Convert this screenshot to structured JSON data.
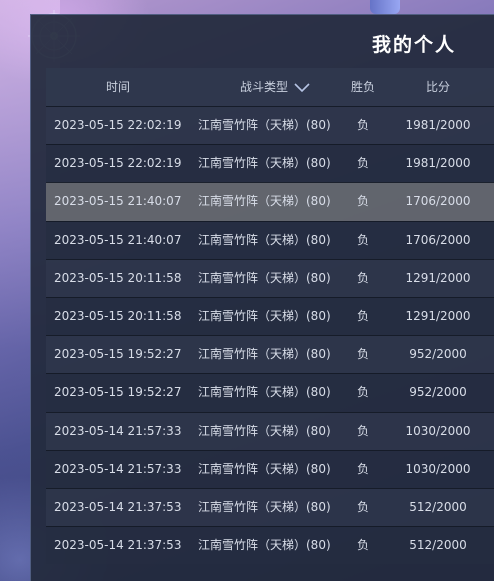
{
  "window": {
    "title": "我的个人"
  },
  "table": {
    "headers": {
      "time": "时间",
      "type": "战斗类型",
      "result": "胜负",
      "score": "比分"
    },
    "sort_icon": "chevron-down-icon",
    "rows": [
      {
        "time": "2023-05-15 22:02:19",
        "type": "江南雪竹阵（天梯）(80)",
        "result": "负",
        "score": "1981/2000"
      },
      {
        "time": "2023-05-15 22:02:19",
        "type": "江南雪竹阵（天梯）(80)",
        "result": "负",
        "score": "1981/2000"
      },
      {
        "time": "2023-05-15 21:40:07",
        "type": "江南雪竹阵（天梯）(80)",
        "result": "负",
        "score": "1706/2000"
      },
      {
        "time": "2023-05-15 21:40:07",
        "type": "江南雪竹阵（天梯）(80)",
        "result": "负",
        "score": "1706/2000"
      },
      {
        "time": "2023-05-15 20:11:58",
        "type": "江南雪竹阵（天梯）(80)",
        "result": "负",
        "score": "1291/2000"
      },
      {
        "time": "2023-05-15 20:11:58",
        "type": "江南雪竹阵（天梯）(80)",
        "result": "负",
        "score": "1291/2000"
      },
      {
        "time": "2023-05-15 19:52:27",
        "type": "江南雪竹阵（天梯）(80)",
        "result": "负",
        "score": "952/2000"
      },
      {
        "time": "2023-05-15 19:52:27",
        "type": "江南雪竹阵（天梯）(80)",
        "result": "负",
        "score": "952/2000"
      },
      {
        "time": "2023-05-14 21:57:33",
        "type": "江南雪竹阵（天梯）(80)",
        "result": "负",
        "score": "1030/2000"
      },
      {
        "time": "2023-05-14 21:57:33",
        "type": "江南雪竹阵（天梯）(80)",
        "result": "负",
        "score": "1030/2000"
      },
      {
        "time": "2023-05-14 21:37:53",
        "type": "江南雪竹阵（天梯）(80)",
        "result": "负",
        "score": "512/2000"
      },
      {
        "time": "2023-05-14 21:37:53",
        "type": "江南雪竹阵（天梯）(80)",
        "result": "负",
        "score": "512/2000"
      }
    ],
    "selected_row_index": 2
  }
}
